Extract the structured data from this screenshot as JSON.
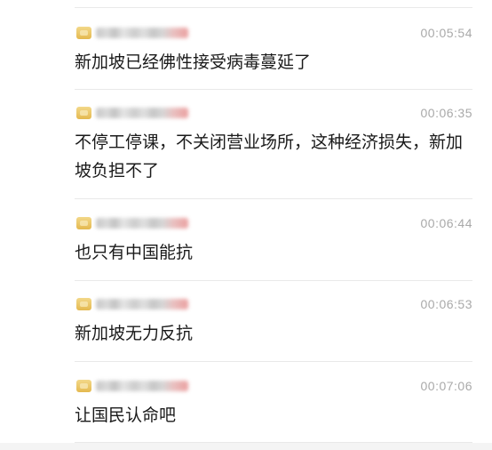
{
  "messages": [
    {
      "time": "00:05:54",
      "text": "新加坡已经佛性接受病毒蔓延了"
    },
    {
      "time": "00:06:35",
      "text": "不停工停课，不关闭营业场所，这种经济损失，新加坡负担不了"
    },
    {
      "time": "00:06:44",
      "text": "也只有中国能抗"
    },
    {
      "time": "00:06:53",
      "text": "新加坡无力反抗"
    },
    {
      "time": "00:07:06",
      "text": "让国民认命吧"
    }
  ]
}
